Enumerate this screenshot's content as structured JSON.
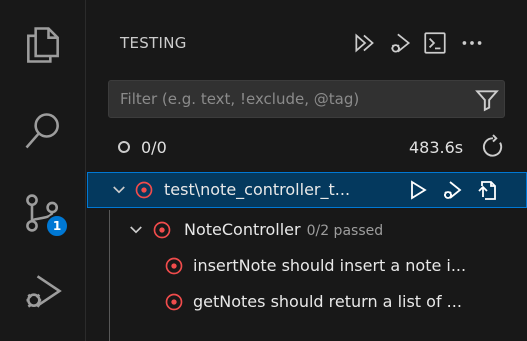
{
  "activity_bar": {
    "items": [
      {
        "name": "explorer",
        "icon": "files-icon"
      },
      {
        "name": "search",
        "icon": "search-icon"
      },
      {
        "name": "source-control",
        "icon": "source-control-icon",
        "badge": "1"
      },
      {
        "name": "run-and-debug",
        "icon": "run-debug-icon"
      }
    ]
  },
  "sidebar": {
    "title": "TESTING",
    "header_actions": [
      "run-tests-icon",
      "debug-tests-icon",
      "terminal-icon",
      "more-actions-icon"
    ],
    "filter": {
      "placeholder": "Filter (e.g. text, !exclude, @tag)",
      "value": ""
    },
    "summary": {
      "count": "0/0",
      "duration": "483.6s"
    },
    "tree": [
      {
        "label": "test\\note_controller_t...",
        "level": 0,
        "expanded": true,
        "selected": true,
        "status": "failed",
        "actions": [
          "run-test-icon",
          "debug-test-icon",
          "go-to-file-icon"
        ]
      },
      {
        "label": "NoteController",
        "meta": "0/2 passed",
        "level": 1,
        "expanded": true,
        "status": "failed"
      },
      {
        "label": "insertNote should insert a note i...",
        "level": 2,
        "status": "failed"
      },
      {
        "label": "getNotes should return a list of ...",
        "level": 2,
        "status": "failed"
      }
    ]
  },
  "colors": {
    "background": "#181818",
    "accent": "#0078d4",
    "selection": "#04395e",
    "error": "#f14c4c",
    "text": "#cccccc"
  }
}
